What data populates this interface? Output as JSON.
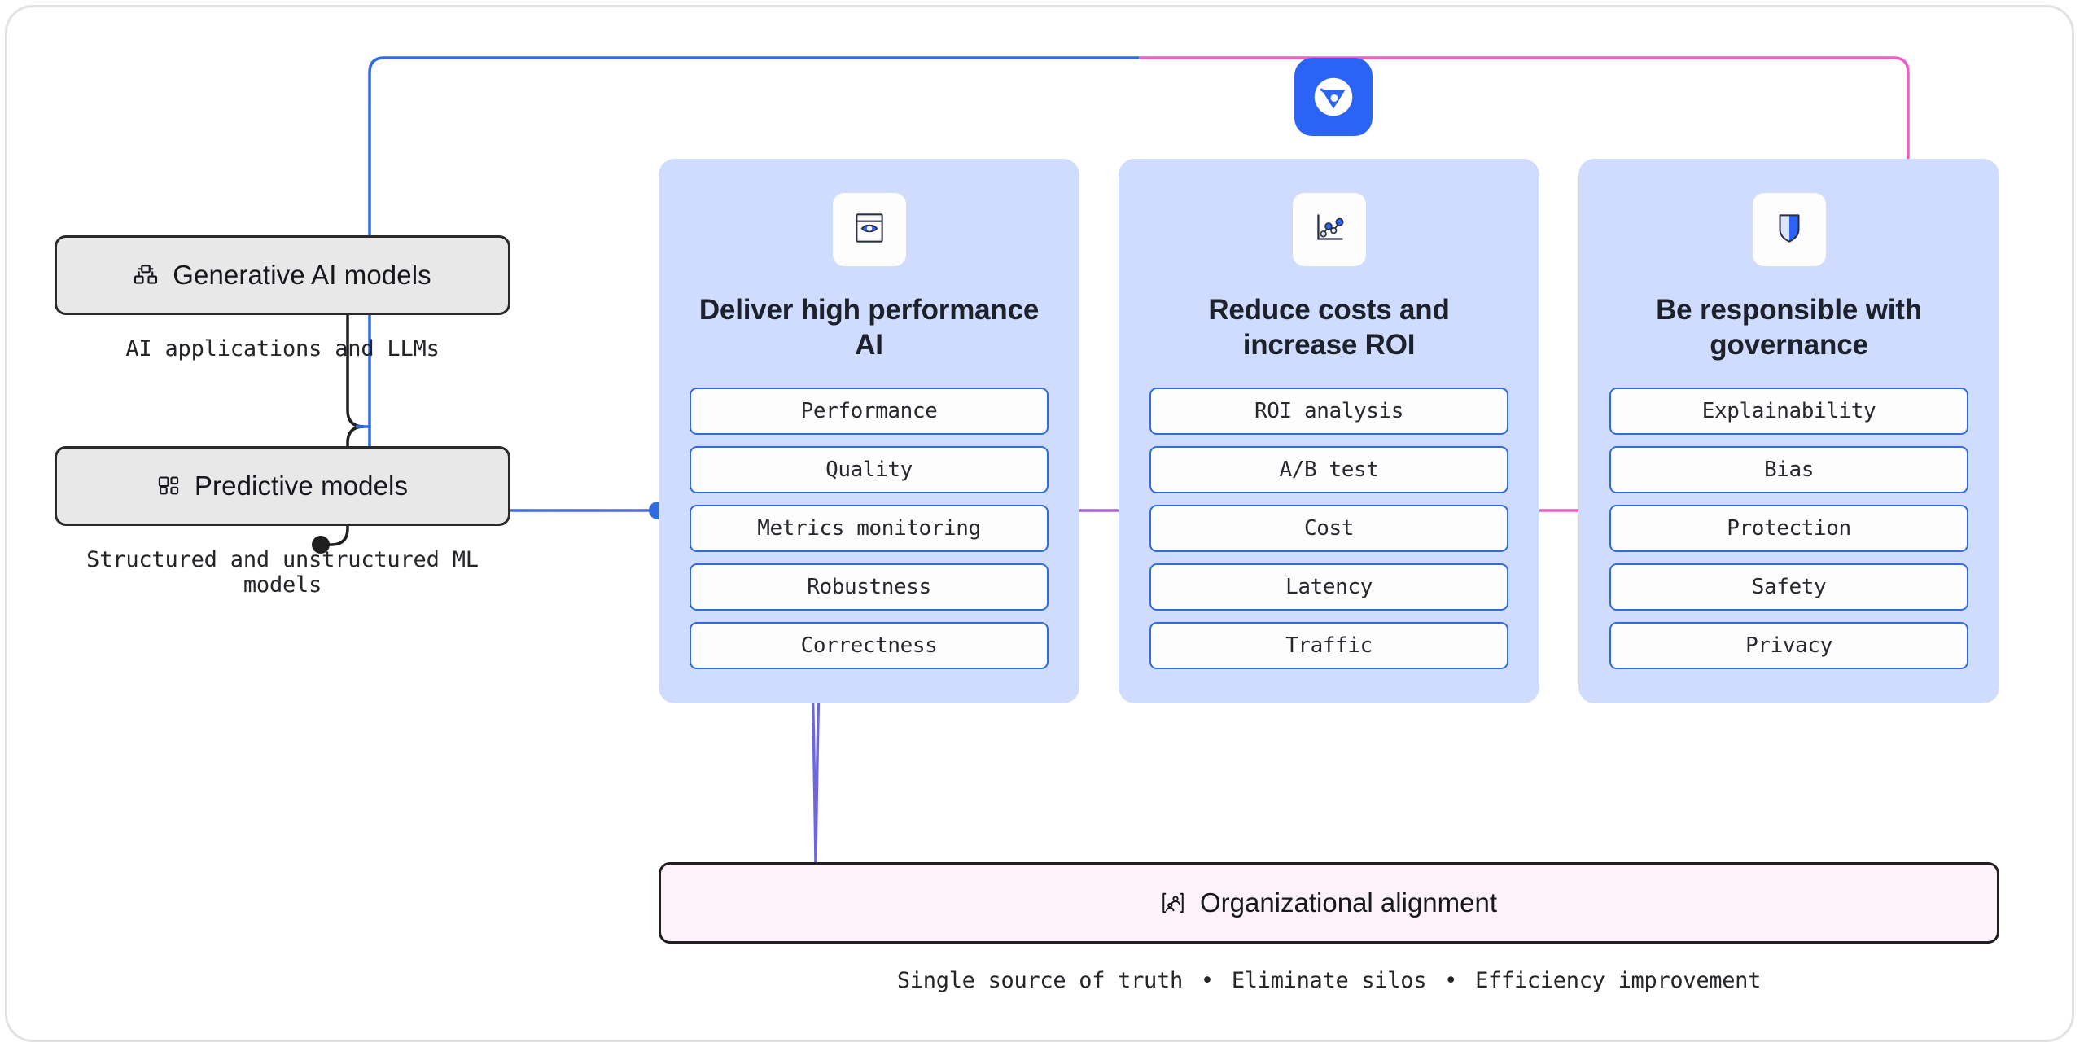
{
  "colors": {
    "brand_blue": "#2b63f6",
    "frame_blue": "#2f6ce0",
    "frame_pink": "#ec5fc4",
    "card_bg": "#cfdcfd",
    "pill_border": "#2f6ce0",
    "org_bar_bg": "#fdf2f9",
    "model_box_bg": "#e8e8e8",
    "line_black": "#1f1f1f"
  },
  "logo": {
    "icon": "evidently-logo-icon"
  },
  "left_column": {
    "items": [
      {
        "label": "Generative AI models",
        "icon": "boxes-icon",
        "caption": "AI applications and LLMs"
      },
      {
        "label": "Predictive models",
        "icon": "layout-dashboard-icon",
        "caption": "Structured and unstructured ML models"
      }
    ]
  },
  "cards": [
    {
      "icon": "monitoring-eye-icon",
      "title": "Deliver high performance AI",
      "pills": [
        "Performance",
        "Quality",
        "Metrics monitoring",
        "Robustness",
        "Correctness"
      ]
    },
    {
      "icon": "line-chart-icon",
      "title": "Reduce costs and increase ROI",
      "pills": [
        "ROI analysis",
        "A/B test",
        "Cost",
        "Latency",
        "Traffic"
      ]
    },
    {
      "icon": "shield-icon",
      "title": "Be responsible with governance",
      "pills": [
        "Explainability",
        "Bias",
        "Protection",
        "Safety",
        "Privacy"
      ]
    }
  ],
  "org_alignment": {
    "icon": "users-frame-icon",
    "label": "Organizational alignment",
    "caption_parts": [
      "Single source of truth",
      "Eliminate silos",
      "Efficiency improvement"
    ],
    "caption_separator": "•"
  }
}
